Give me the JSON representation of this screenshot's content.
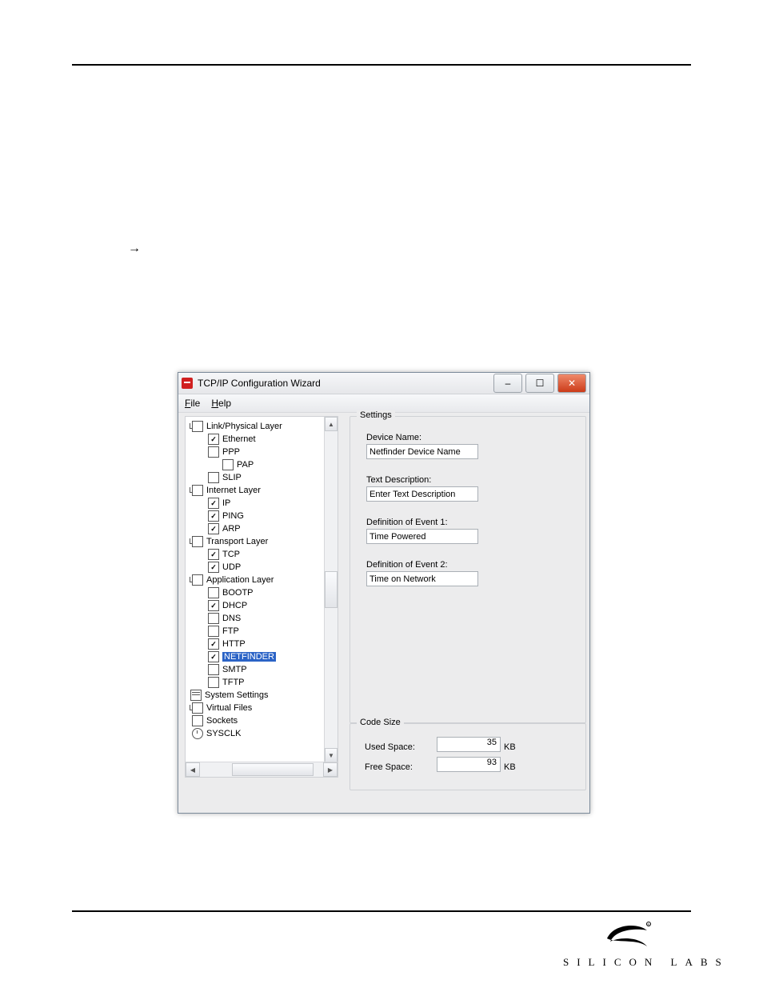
{
  "page": {
    "arrow": "→"
  },
  "window": {
    "title": "TCP/IP Configuration Wizard",
    "menu": {
      "file": "File",
      "file_u": "F",
      "help": "Help",
      "help_u": "H"
    },
    "buttons": {
      "min": "–",
      "max": "☐",
      "close": "✕"
    }
  },
  "tree": {
    "link_layer": "Link/Physical Layer",
    "ethernet": "Ethernet",
    "ppp": "PPP",
    "pap": "PAP",
    "slip": "SLIP",
    "internet_layer": "Internet Layer",
    "ip": "IP",
    "ping": "PING",
    "arp": "ARP",
    "transport_layer": "Transport Layer",
    "tcp": "TCP",
    "udp": "UDP",
    "application_layer": "Application Layer",
    "bootp": "BOOTP",
    "dhcp": "DHCP",
    "dns": "DNS",
    "ftp": "FTP",
    "http": "HTTP",
    "netfinder": "NETFINDER",
    "smtp": "SMTP",
    "tftp": "TFTP",
    "system_settings": "System Settings",
    "virtual_files": "Virtual Files",
    "sockets": "Sockets",
    "sysclk": "SYSCLK"
  },
  "settings": {
    "legend": "Settings",
    "device_name_lbl": "Device Name:",
    "device_name_val": "Netfinder Device Name",
    "text_desc_lbl": "Text Description:",
    "text_desc_val": "Enter Text Description",
    "event1_lbl": "Definition of Event 1:",
    "event1_val": "Time Powered",
    "event2_lbl": "Definition of Event 2:",
    "event2_val": "Time on Network"
  },
  "code_size": {
    "legend": "Code Size",
    "used_lbl": "Used Space:",
    "used_val": "35",
    "free_lbl": "Free Space:",
    "free_val": "93",
    "unit": "KB"
  },
  "logo": {
    "text": "SILICON LABS"
  }
}
